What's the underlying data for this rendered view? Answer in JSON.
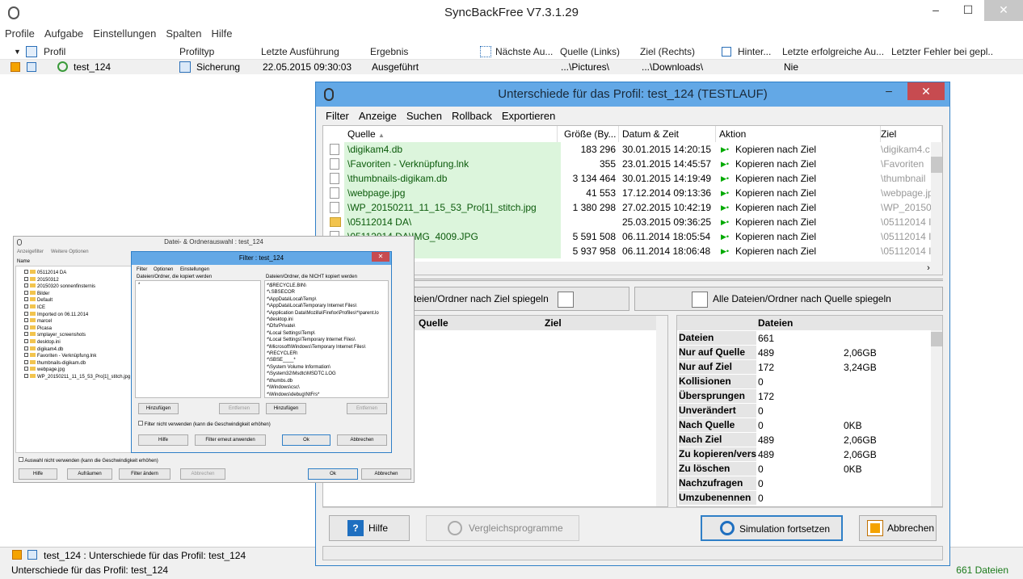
{
  "app": {
    "title": "SyncBackFree V7.3.1.29",
    "menu": [
      "Profile",
      "Aufgabe",
      "Einstellungen",
      "Spalten",
      "Hilfe"
    ]
  },
  "columns": [
    "Profil",
    "Profiltyp",
    "Letzte Ausführung",
    "Ergebnis",
    "Nächste Au...",
    "Quelle (Links)",
    "Ziel (Rechts)",
    "Hinter...",
    "Letzte erfolgreiche Au...",
    "Letzter Fehler bei gepl..."
  ],
  "profile_row": {
    "name": "test_124",
    "type": "Sicherung",
    "last_run": "22.05.2015 09:30:03",
    "result": "Ausgeführt",
    "source": "...\\Pictures\\",
    "target": "...\\Downloads\\",
    "last_success": "Nie"
  },
  "status": {
    "line1": "test_124 : Unterschiede für das Profil: test_124",
    "line2": "Unterschiede für das Profil: test_124",
    "count": "661 Dateien"
  },
  "diff": {
    "title": "Unterschiede für das Profil: test_124 (TESTLAUF)",
    "menu": [
      "Filter",
      "Anzeige",
      "Suchen",
      "Rollback",
      "Exportieren"
    ],
    "headers": {
      "source": "Quelle",
      "size": "Größe (By...",
      "date": "Datum & Zeit",
      "action": "Aktion",
      "target": "Ziel"
    },
    "rows": [
      {
        "src": "\\digikam4.db",
        "size": "183 296",
        "date": "30.01.2015 14:20:15",
        "action": "Kopieren nach Ziel",
        "tgt": "\\digikam4.c"
      },
      {
        "src": "\\Favoriten - Verknüpfung.lnk",
        "size": "355",
        "date": "23.01.2015 14:45:57",
        "action": "Kopieren nach Ziel",
        "tgt": "\\Favoriten"
      },
      {
        "src": "\\thumbnails-digikam.db",
        "size": "3 134 464",
        "date": "30.01.2015 14:19:49",
        "action": "Kopieren nach Ziel",
        "tgt": "\\thumbnail"
      },
      {
        "src": "\\webpage.jpg",
        "size": "41 553",
        "date": "17.12.2014 09:13:36",
        "action": "Kopieren nach Ziel",
        "tgt": "\\webpage.jp"
      },
      {
        "src": "\\WP_20150211_11_15_53_Pro[1]_stitch.jpg",
        "size": "1 380 298",
        "date": "27.02.2015 10:42:19",
        "action": "Kopieren nach Ziel",
        "tgt": "\\WP_20150"
      },
      {
        "src": "\\05112014 DA\\",
        "size": "",
        "date": "25.03.2015 09:36:25",
        "action": "Kopieren nach Ziel",
        "tgt": "\\05112014 I"
      },
      {
        "src": "\\05112014 DA\\IMG_4009.JPG",
        "size": "5 591 508",
        "date": "06.11.2014 18:05:54",
        "action": "Kopieren nach Ziel",
        "tgt": "\\05112014 I"
      },
      {
        "src": "IMG_4010.JPG",
        "size": "5 937 958",
        "date": "06.11.2014 18:06:48",
        "action": "Kopieren nach Ziel",
        "tgt": "\\05112014 I"
      }
    ],
    "mirror_left": "teien/Ordner nach Ziel spiegeln",
    "mirror_right": "Alle Dateien/Ordner nach Quelle spiegeln",
    "sub_headers": {
      "source": "Quelle",
      "target": "Ziel"
    },
    "stats_header": "Dateien",
    "stats": [
      {
        "k": "Dateien",
        "v1": "661",
        "v2": ""
      },
      {
        "k": "Nur auf Quelle",
        "v1": "489",
        "v2": "2,06GB"
      },
      {
        "k": "Nur auf Ziel",
        "v1": "172",
        "v2": "3,24GB"
      },
      {
        "k": "Kollisionen",
        "v1": "0",
        "v2": ""
      },
      {
        "k": "Übersprungen",
        "v1": "172",
        "v2": ""
      },
      {
        "k": "Unverändert",
        "v1": "0",
        "v2": ""
      },
      {
        "k": "Nach Quelle",
        "v1": "0",
        "v2": "0KB"
      },
      {
        "k": "Nach Ziel",
        "v1": "489",
        "v2": "2,06GB"
      },
      {
        "k": "Zu kopieren/versc",
        "v1": "489",
        "v2": "2,06GB"
      },
      {
        "k": "Zu löschen",
        "v1": "0",
        "v2": "0KB"
      },
      {
        "k": "Nachzufragen",
        "v1": "0",
        "v2": ""
      },
      {
        "k": "Umzubenennen",
        "v1": "0",
        "v2": ""
      }
    ],
    "buttons": {
      "help": "Hilfe",
      "compare": "Vergleichsprogramme",
      "continue": "Simulation fortsetzen",
      "cancel": "Abbrechen"
    }
  },
  "w1": {
    "title": "Datei- & Ordnerauswahl : test_124",
    "tabs": [
      "Anzeigefilter",
      "Weitere Optionen"
    ],
    "col": "Name",
    "tree": [
      "05112014 DA",
      "20150312",
      "20150320 sonnenfinsternis",
      "Bilder",
      "Default",
      "ICE",
      "Imported on 06.11.2014",
      "marcel",
      "Picasa",
      "smplayer_screenshots",
      "desktop.ini",
      "digikam4.db",
      "Favoriten - Verknüpfung.lnk",
      "thumbnails-digikam.db",
      "webpage.jpg",
      "WP_20150211_11_15_53_Pro[1]_stitch.jpg"
    ],
    "checkbox": "Auswahl nicht verwenden (kann die Geschwindigkeit erhöhen)",
    "buttons": [
      "Hilfe",
      "Aufräumen",
      "Filter ändern",
      "Abbrechen",
      "Ok",
      "Abbrechen"
    ]
  },
  "w2": {
    "title": "Filter : test_124",
    "menu": [
      "Filter",
      "Optionen",
      "Einstellungen"
    ],
    "left_header": "Dateien/Ordner, die kopiert werden",
    "right_header": "Dateien/Ordner, die NICHT kopiert werden",
    "left_items": [
      "*"
    ],
    "right_items": [
      "*\\$RECYCLE.BIN\\",
      "*\\.SBSECOR",
      "*\\AppData\\Local\\Temp\\",
      "*\\AppData\\Local\\Temporary Internet Files\\",
      "*\\Application Data\\Mozilla\\Firefox\\Profiles\\*\\parent.lo",
      "*\\desktop.ini",
      "*\\DfsrPrivate\\",
      "*\\Local Settings\\Temp\\",
      "*\\Local Settings\\Temporary Internet Files\\",
      "*\\Microsoft\\Windows\\Temporary Internet Files\\",
      "*\\RECYCLER\\",
      "*\\SBSE____*",
      "*\\System Volume Information\\",
      "*\\System32\\Msdtc\\MSDTC.LOG",
      "*\\thumbs.db",
      "*\\Windows\\csc\\",
      "*\\Windows\\debug\\NtFrs*"
    ],
    "add": "Hinzufügen",
    "remove": "Entfernen",
    "checkbox": "Filter nicht verwenden (kann die Geschwindigkeit erhöhen)",
    "buttons": [
      "Hilfe",
      "Filter erneut anwenden",
      "Ok",
      "Abbrechen"
    ]
  }
}
